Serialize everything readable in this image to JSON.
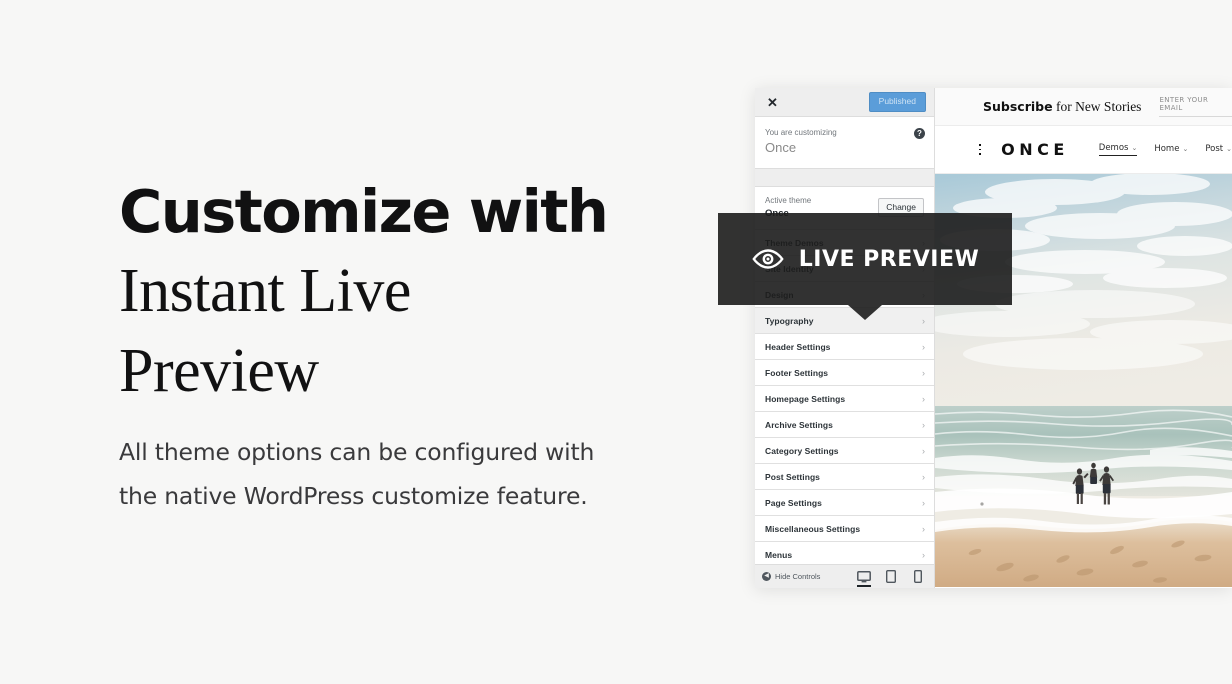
{
  "marketing": {
    "headline_line1": "Customize with",
    "headline_line2": "Instant Live",
    "headline_line3": "Preview",
    "subcopy_line1": "All theme options can be configured with",
    "subcopy_line2": "the native WordPress customize feature."
  },
  "overlay": {
    "label": "LIVE PREVIEW",
    "icon": "eye-icon"
  },
  "customizer": {
    "close_label": "✕",
    "publish_label": "Published",
    "customizing_label": "You are customizing",
    "site_title": "Once",
    "help_label": "?",
    "active_theme_label": "Active theme",
    "active_theme_name": "Once",
    "change_label": "Change",
    "menu_items": [
      {
        "label": "Theme Demos"
      },
      {
        "label": "Site Identity"
      },
      {
        "label": "Design"
      },
      {
        "label": "Typography"
      },
      {
        "label": "Header Settings"
      },
      {
        "label": "Footer Settings"
      },
      {
        "label": "Homepage Settings"
      },
      {
        "label": "Archive Settings"
      },
      {
        "label": "Category Settings"
      },
      {
        "label": "Post Settings"
      },
      {
        "label": "Page Settings"
      },
      {
        "label": "Miscellaneous Settings"
      },
      {
        "label": "Menus"
      }
    ],
    "chevron": "›",
    "hide_controls_label": "Hide Controls",
    "devices": [
      {
        "name": "desktop",
        "active": true
      },
      {
        "name": "tablet",
        "active": false
      },
      {
        "name": "mobile",
        "active": false
      }
    ]
  },
  "preview_site": {
    "subscribe_bold": "Subscribe",
    "subscribe_rest": " for New Stories",
    "email_placeholder": "ENTER YOUR EMAIL",
    "brand": "ONCE",
    "nav": [
      {
        "label": "Demos",
        "active": true
      },
      {
        "label": "Home",
        "active": false
      },
      {
        "label": "Post",
        "active": false
      }
    ],
    "chevron_down": "⌄",
    "hero_alt": "three people running into ocean waves at a sandy beach"
  },
  "colors": {
    "page_bg": "#f7f7f6",
    "publish_blue": "#5b9dd9",
    "edit_badge_blue": "#3a8dc4",
    "overlay_dark": "#1c1c1c",
    "text_dark": "#111112"
  }
}
